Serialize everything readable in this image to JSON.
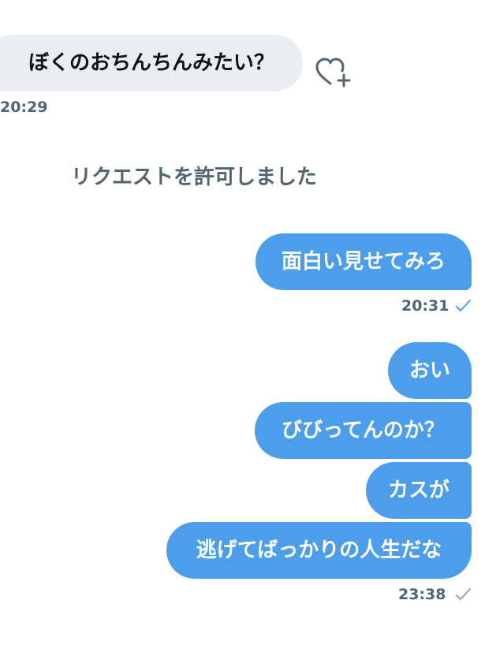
{
  "thread": {
    "incoming_message": {
      "text": "ぼくのおちんちんみたい？",
      "time": "20:29"
    },
    "system_notice": "リクエストを許可しました",
    "outgoing_group_1": {
      "messages": [
        "面白い見せてみろ"
      ],
      "time": "20:31",
      "status_icon": "check-icon",
      "status_color": "#4c9deb"
    },
    "outgoing_group_2": {
      "messages": [
        "おい",
        "びびってんのか？",
        "カスが",
        "逃げてばっかりの人生だな"
      ],
      "time": "23:38",
      "status_icon": "check-icon",
      "status_color": "#9aa5b0"
    }
  },
  "icons": {
    "reaction": "heart-plus-icon"
  },
  "colors": {
    "outgoing_bubble": "#4c9deb",
    "incoming_bubble": "#ebedf0",
    "secondary_text": "#536471"
  }
}
